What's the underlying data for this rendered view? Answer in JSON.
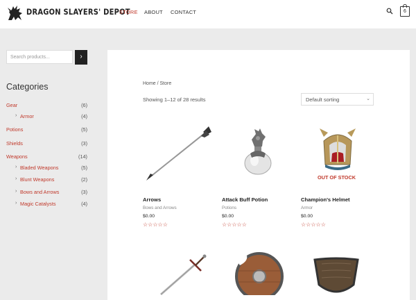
{
  "site": {
    "title": "DRAGON SLAYERS' DEPOT"
  },
  "nav": {
    "store": "STORE",
    "about": "ABOUT",
    "contact": "CONTACT"
  },
  "cart": {
    "count": "6"
  },
  "sidebar": {
    "search_placeholder": "Search products...",
    "search_button": "›",
    "categories_title": "Categories",
    "categories": [
      {
        "label": "Gear",
        "count": "(6)"
      },
      {
        "label": "Armor",
        "count": "(4)"
      },
      {
        "label": "Potions",
        "count": "(5)"
      },
      {
        "label": "Shields",
        "count": "(3)"
      },
      {
        "label": "Weapons",
        "count": "(14)"
      },
      {
        "label": "Bladed Weapons",
        "count": "(5)"
      },
      {
        "label": "Blunt Weapons",
        "count": "(2)"
      },
      {
        "label": "Bows and Arrows",
        "count": "(3)"
      },
      {
        "label": "Magic Catalysts",
        "count": "(4)"
      }
    ]
  },
  "shop": {
    "breadcrumb": "Home / Store",
    "result_count": "Showing 1–12 of 28 results",
    "sort_selected": "Default sorting"
  },
  "products": [
    {
      "title": "Arrows",
      "category": "Bows and Arrows",
      "price": "$0.00",
      "stars": "☆☆☆☆☆"
    },
    {
      "title": "Attack Buff Potion",
      "category": "Potions",
      "price": "$0.00",
      "stars": "☆☆☆☆☆"
    },
    {
      "title": "Champion's Helmet",
      "category": "Armor",
      "price": "$0.00",
      "stars": "☆☆☆☆☆",
      "badge": "OUT OF STOCK"
    }
  ],
  "colors": {
    "accent": "#c0392b",
    "page_bg": "#ebebeb"
  }
}
